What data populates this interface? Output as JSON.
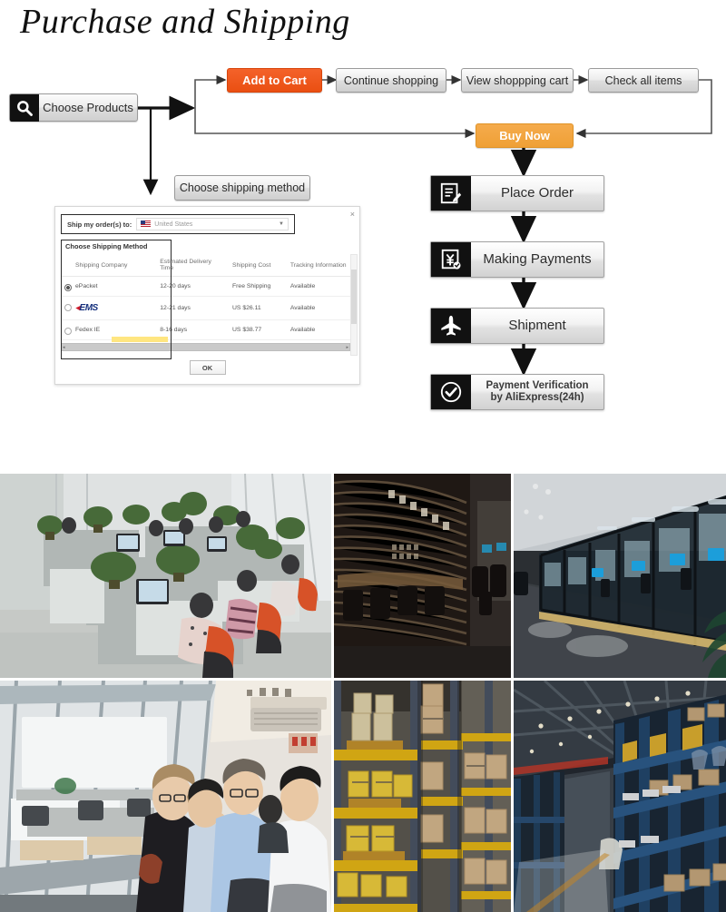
{
  "page": {
    "title": "Purchase and Shipping"
  },
  "flow": {
    "choose_products": "Choose Products",
    "add_to_cart": "Add to Cart",
    "continue_shopping": "Continue shopping",
    "view_cart": "View shoppping cart",
    "check_all_items": "Check all items",
    "buy_now": "Buy Now",
    "choose_shipping_method": "Choose shipping method",
    "place_order": "Place Order",
    "making_payments": "Making Payments",
    "shipment": "Shipment",
    "payment_verification_line1": "Payment Verification",
    "payment_verification_line2": "by AliExpress(24h)",
    "colors": {
      "add_to_cart_bg": "#ea4f12",
      "buy_now_bg": "#efa036",
      "box_bg": "#e6e6e6",
      "icon_bg": "#111111",
      "arrow": "#333333"
    }
  },
  "dialog": {
    "close_label": "×",
    "ship_to_label": "Ship my order(s) to:",
    "country": "United States",
    "section_title": "Choose Shipping Method",
    "columns": [
      "Shipping Company",
      "Estimated Delivery Time",
      "Shipping Cost",
      "Tracking Information"
    ],
    "rows": [
      {
        "company": "ePacket",
        "selected": true,
        "delivery": "12-20 days",
        "cost": "Free Shipping",
        "tracking": "Available"
      },
      {
        "company": "EMS",
        "selected": false,
        "delivery": "12-21 days",
        "cost": "US $26.11",
        "tracking": "Available"
      },
      {
        "company": "Fedex IE",
        "selected": false,
        "delivery": "8-16 days",
        "cost": "US $38.77",
        "tracking": "Available"
      }
    ],
    "ok_label": "OK",
    "scroll_left": "◂",
    "scroll_right": "▸"
  },
  "photos": [
    {
      "name": "open-plan-office-with-staff-at-computers"
    },
    {
      "name": "dark-wood-slat-partition-meeting-room"
    },
    {
      "name": "glass-walled-office-corridor"
    },
    {
      "name": "visitors-touring-facility-through-windows"
    },
    {
      "name": "warehouse-yellow-pallet-racking"
    },
    {
      "name": "warehouse-aisle-blue-shelving"
    }
  ]
}
